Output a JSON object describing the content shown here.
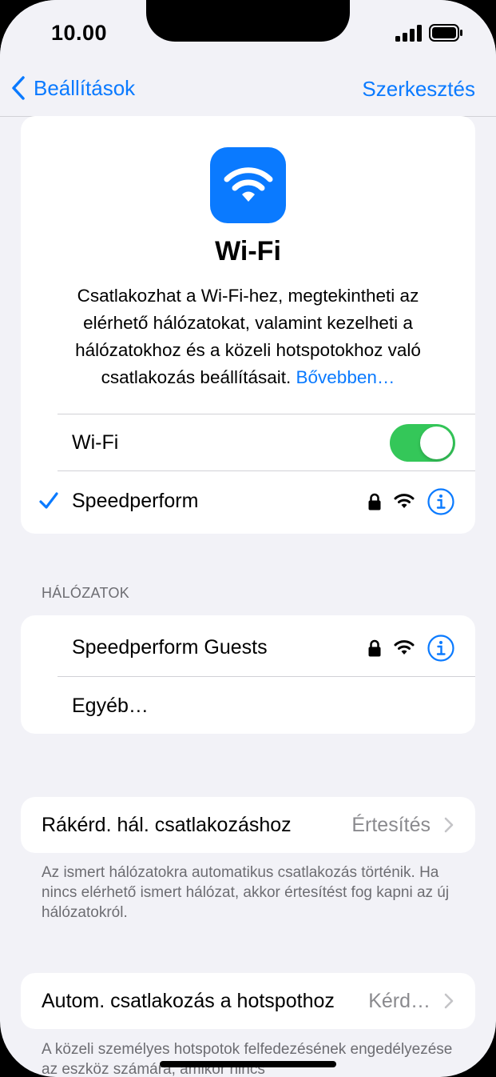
{
  "status_bar": {
    "time": "10.00"
  },
  "nav": {
    "back_label": "Beállítások",
    "edit_label": "Szerkesztés"
  },
  "hero": {
    "title": "Wi-Fi",
    "description": "Csatlakozhat a Wi-Fi-hez, megtekintheti az elérhető hálózatokat, valamint kezelheti a hálózatokhoz és a közeli hotspotokhoz való csatlakozás beállításait.",
    "link": "Bővebben…"
  },
  "wifi_toggle": {
    "label": "Wi-Fi",
    "on": true
  },
  "connected_network": {
    "name": "Speedperform"
  },
  "networks_section": {
    "header": "HÁLÓZATOK",
    "items": [
      {
        "name": "Speedperform Guests"
      },
      {
        "name": "Egyéb…"
      }
    ]
  },
  "ask_to_join": {
    "label": "Rákérd. hál. csatlakozáshoz",
    "value": "Értesítés",
    "footnote": "Az ismert hálózatokra automatikus csatlakozás történik. Ha nincs elérhető ismert hálózat, akkor értesítést fog kapni az új hálózatokról."
  },
  "auto_join_hotspot": {
    "label": "Autom. csatlakozás a hotspothoz",
    "value": "Kérd…",
    "footnote": "A közeli személyes hotspotok felfedezésének engedélyezése az eszköz számára, amikor nincs"
  },
  "colors": {
    "accent": "#0a7aff",
    "toggle_on": "#34c759",
    "background": "#f2f2f7",
    "secondary_text": "#8a8a8e"
  },
  "icons": [
    "wifi-icon",
    "lock-icon",
    "info-icon",
    "checkmark-icon",
    "chevron-left-icon",
    "chevron-right-icon",
    "signal-icon",
    "battery-icon"
  ]
}
